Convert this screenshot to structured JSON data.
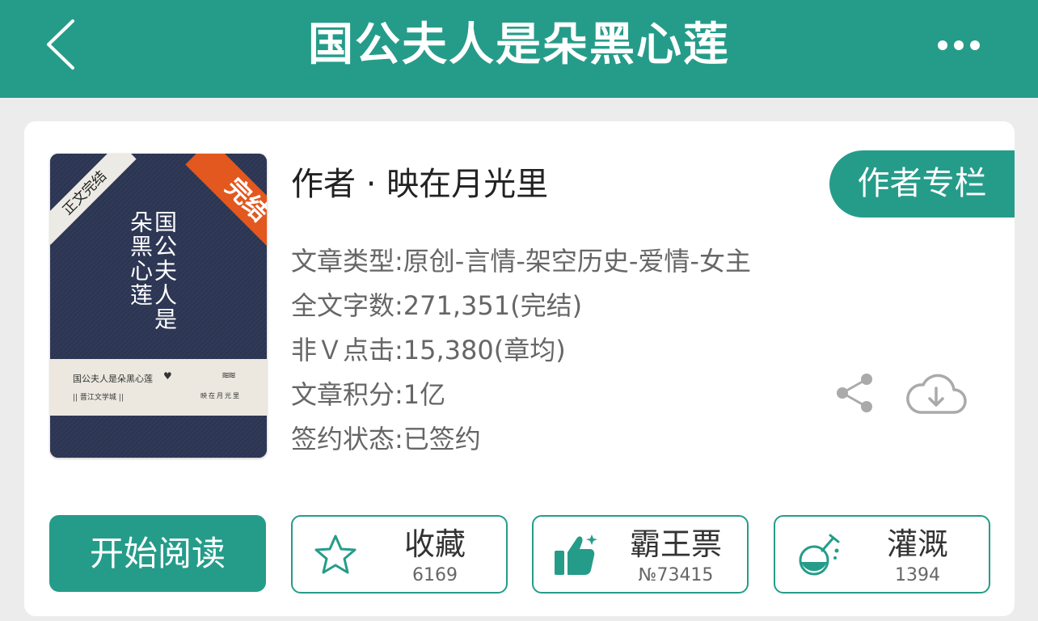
{
  "header": {
    "title": "国公夫人是朵黑心莲",
    "back_icon": "chevron-left-icon",
    "more_icon": "more-horizontal-icon"
  },
  "book": {
    "cover": {
      "title": "国公夫人是朵黑心莲",
      "corner_left": "正文完结",
      "corner_right": "完结",
      "band_title": "国公夫人是朵黑心莲",
      "band_publisher": "|| 晋江文学城 ||",
      "band_author": "映在月光里"
    },
    "author_line": "作者 · 映在月光里",
    "author_column_label": "作者专栏",
    "info": [
      "文章类型:原创-言情-架空历史-爱情-女主",
      "全文字数:271,351(完结)",
      "非Ｖ点击:15,380(章均)",
      "文章积分:1亿",
      "签约状态:已签约"
    ]
  },
  "actions": {
    "start_label": "开始阅读",
    "favorite": {
      "label": "收藏",
      "count": "6169",
      "icon": "star-icon"
    },
    "vote": {
      "label": "霸王票",
      "count": "№73415",
      "icon": "thumbs-up-icon"
    },
    "water": {
      "label": "灌溉",
      "count": "1394",
      "icon": "flask-icon"
    }
  },
  "colors": {
    "accent": "#259c89",
    "cover_bg": "#2c3552",
    "ribbon": "#e2581e",
    "background": "#ececec"
  }
}
